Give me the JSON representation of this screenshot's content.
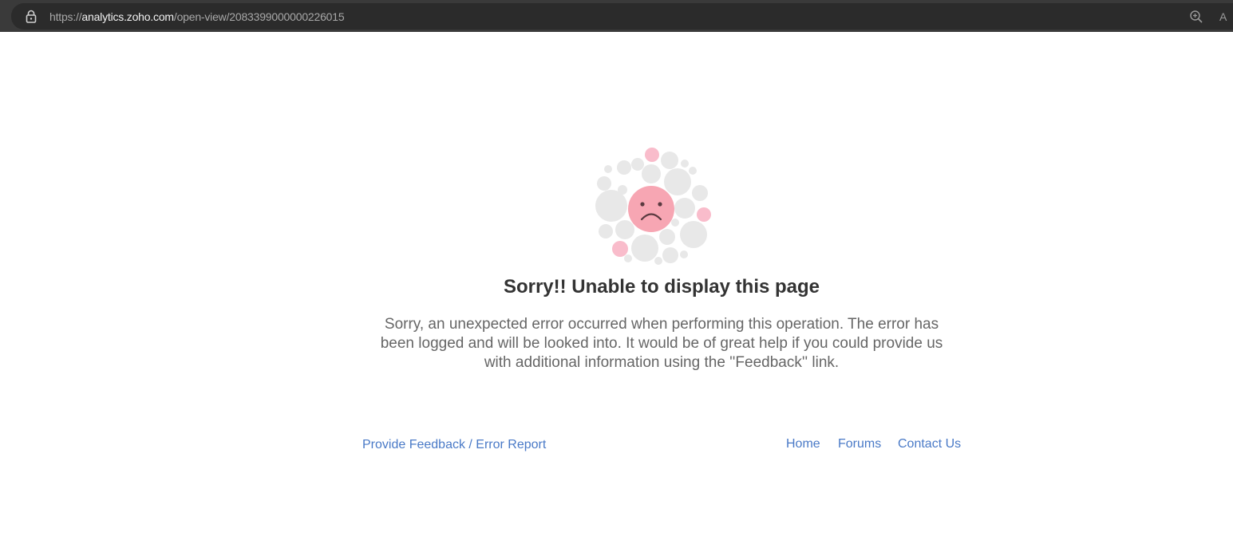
{
  "browser": {
    "url_prefix": "https://",
    "url_host": "analytics.zoho.com",
    "url_path": "/open-view/2083399000000226015",
    "read_aloud_glyph": "A"
  },
  "error": {
    "title": "Sorry!! Unable to display this page",
    "message": "Sorry, an unexpected error occurred when performing this operation. The error has been logged and will be looked into. It would be of great help if you could provide us with additional information using the ''Feedback'' link."
  },
  "links": {
    "feedback": "Provide Feedback / Error Report",
    "home": "Home",
    "forums": "Forums",
    "contact": "Contact Us"
  },
  "colors": {
    "link": "#4a7ac7",
    "face": "#f7a6b3",
    "bubble_grey": "#e8e8e8",
    "bubble_pink": "#f9bccb",
    "title": "#333333",
    "message": "#666666"
  },
  "icons": {
    "lock": "lock-icon",
    "zoom": "zoom-in-icon",
    "read_aloud": "read-aloud-icon",
    "illustration": "sad-face-icon"
  }
}
